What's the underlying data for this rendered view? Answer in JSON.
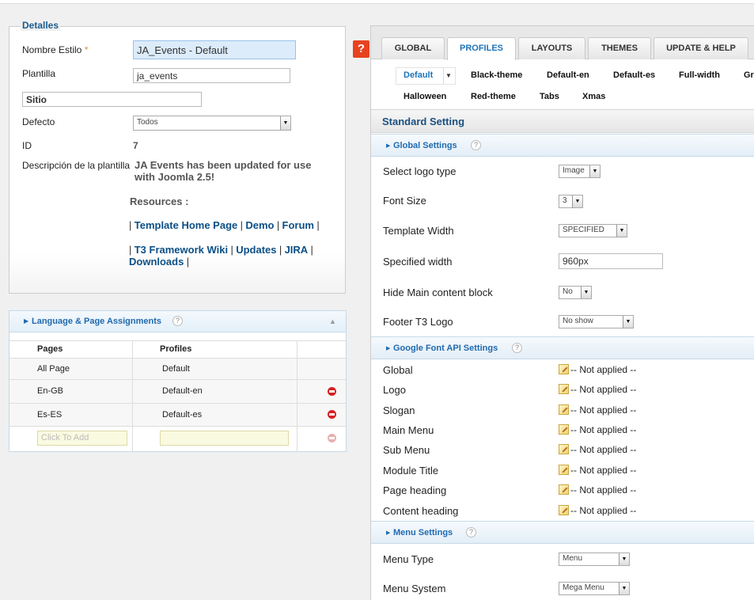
{
  "details": {
    "legend": "Detalles",
    "style_name_label": "Nombre Estilo",
    "required_mark": "*",
    "style_name_value": "JA_Events - Default",
    "template_label": "Plantilla",
    "template_value": "ja_events",
    "site_value": "Sitio",
    "default_label": "Defecto",
    "default_value": "Todos",
    "id_label": "ID",
    "id_value": "7",
    "description_label": "Descripción de la plantilla",
    "description_line1": "JA Events has been updated for use",
    "description_line2": "with Joomla 2.5!",
    "resources_label": "Resources :",
    "links": {
      "template_home": "Template Home Page",
      "demo": "Demo",
      "forum": "Forum",
      "t3_wiki": "T3 Framework Wiki",
      "updates": "Updates",
      "jira": "JIRA",
      "downloads": "Downloads"
    },
    "separator": "|"
  },
  "assignments": {
    "title": "Language & Page Assignments",
    "help": "?",
    "col_pages": "Pages",
    "col_profiles": "Profiles",
    "rows": [
      {
        "page": "All Page",
        "profile": "Default"
      },
      {
        "page": "En-GB",
        "profile": "Default-en"
      },
      {
        "page": "Es-ES",
        "profile": "Default-es"
      }
    ],
    "add_placeholder": "Click To Add"
  },
  "help_button": "?",
  "tabs": [
    "GLOBAL",
    "PROFILES",
    "LAYOUTS",
    "THEMES",
    "UPDATE & HELP"
  ],
  "active_tab": "PROFILES",
  "profiles": {
    "row1": [
      "Default",
      "Black-theme",
      "Default-en",
      "Default-es",
      "Full-width",
      "Gr"
    ],
    "row2": [
      "Halloween",
      "Red-theme",
      "Tabs",
      "Xmas"
    ],
    "active": "Default"
  },
  "standard": {
    "title": "Standard Setting",
    "global_title": "Global Settings",
    "help": "?",
    "fields": {
      "logo_type_label": "Select logo type",
      "logo_type_value": "Image",
      "font_size_label": "Font Size",
      "font_size_value": "3",
      "template_width_label": "Template Width",
      "template_width_value": "SPECIFIED",
      "specified_width_label": "Specified width",
      "specified_width_value": "960px",
      "hide_main_label": "Hide Main content block",
      "hide_main_value": "No",
      "footer_logo_label": "Footer T3 Logo",
      "footer_logo_value": "No show"
    },
    "gfont_title": "Google Font API Settings",
    "gfonts": [
      {
        "label": "Global",
        "value": "-- Not applied --"
      },
      {
        "label": "Logo",
        "value": "-- Not applied --"
      },
      {
        "label": "Slogan",
        "value": "-- Not applied --"
      },
      {
        "label": "Main Menu",
        "value": "-- Not applied --"
      },
      {
        "label": "Sub Menu",
        "value": "-- Not applied --"
      },
      {
        "label": "Module Title",
        "value": "-- Not applied --"
      },
      {
        "label": "Page heading",
        "value": "-- Not applied --"
      },
      {
        "label": "Content heading",
        "value": "-- Not applied --"
      }
    ],
    "menu_title": "Menu Settings",
    "menu_type_label": "Menu Type",
    "menu_type_value": "Menu",
    "menu_system_label": "Menu System",
    "menu_system_value": "Mega Menu"
  },
  "colors": {
    "link": "#0b4f86",
    "tab_active": "#1f74ba",
    "help_orange": "#e7431f",
    "remove_red": "#d81f1f"
  }
}
